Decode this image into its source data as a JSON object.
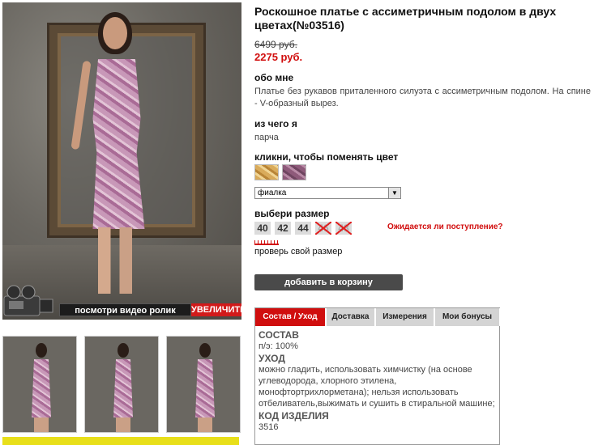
{
  "product": {
    "title": "Роскошное платье с ассиметричным подолом в двух цветах(№03516)",
    "old_price": "6499 руб.",
    "new_price": "2275 руб."
  },
  "about": {
    "heading": "обо мне",
    "text": "Платье без рукавов приталенного силуэта с ассиметричным подолом. На спине - V-образный вырез."
  },
  "material": {
    "heading": "из чего я",
    "text": "парча"
  },
  "color": {
    "heading": "кликни, чтобы поменять цвет",
    "selected": "фиалка",
    "swatches": [
      "gold",
      "violet"
    ]
  },
  "size": {
    "heading": "выбери размер",
    "options": [
      {
        "label": "40",
        "available": true
      },
      {
        "label": "42",
        "available": true
      },
      {
        "label": "44",
        "available": true
      },
      {
        "label": "46",
        "available": false
      },
      {
        "label": "48",
        "available": false
      }
    ],
    "awaiting_link": "Ожидается ли поступление?",
    "check_size": "проверь свой размер"
  },
  "cart": {
    "button": "добавить в корзину"
  },
  "gallery": {
    "video_label": "посмотри видео ролик",
    "zoom_label": "УВЕЛИЧИТЬ"
  },
  "tabs": {
    "items": [
      "Состав / Уход",
      "Доставка",
      "Измерения",
      "Мои бонусы"
    ],
    "content": {
      "composition_heading": "СОСТАВ",
      "composition": "п/э: 100%",
      "care_heading": "УХОД",
      "care": "можно гладить, использовать химчистку (на основе углеводорода, хлорного этилена, монофтортрихлорметана); нельзя использовать отбеливатель,выжимать и сушить в стиральной машине;",
      "code_heading": "КОД ИЗДЕЛИЯ",
      "code": "3516"
    }
  },
  "colors": {
    "accent": "#d10d0d",
    "button_dark": "#4a4a4a"
  }
}
